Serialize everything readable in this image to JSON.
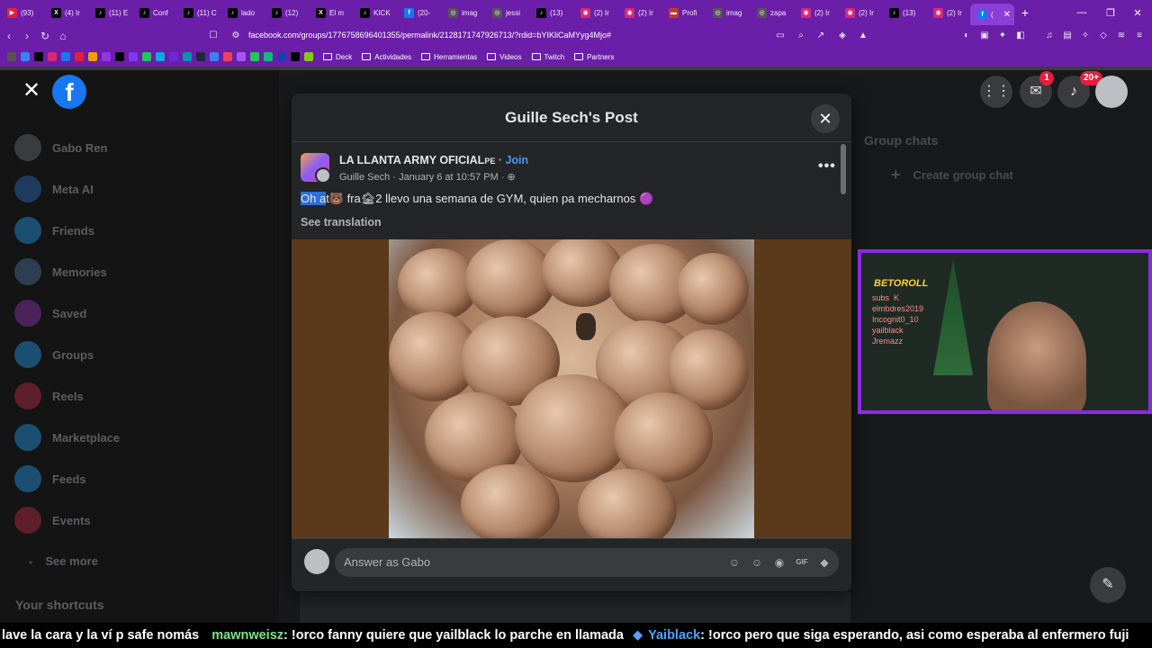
{
  "browser": {
    "tabs": [
      {
        "label": "(93)",
        "color": "#e41e3f",
        "glyph": "▶"
      },
      {
        "label": "(4) Ir",
        "color": "#000000",
        "glyph": "X"
      },
      {
        "label": "(11) E",
        "color": "#000000",
        "glyph": "♪"
      },
      {
        "label": "Conf",
        "color": "#000000",
        "glyph": "♪"
      },
      {
        "label": "(11) C",
        "color": "#000000",
        "glyph": "♪"
      },
      {
        "label": "lado",
        "color": "#000000",
        "glyph": "♪"
      },
      {
        "label": "(12) ",
        "color": "#000000",
        "glyph": "♪"
      },
      {
        "label": "El m",
        "color": "#000000",
        "glyph": "X"
      },
      {
        "label": "KICK",
        "color": "#000000",
        "glyph": "♪"
      },
      {
        "label": "(20-",
        "color": "#1877f2",
        "glyph": "f"
      },
      {
        "label": "imag",
        "color": "#555555",
        "glyph": "◎"
      },
      {
        "label": "jessi",
        "color": "#555555",
        "glyph": "◎"
      },
      {
        "label": "(13) ",
        "color": "#000000",
        "glyph": "♪"
      },
      {
        "label": "(2) Ir",
        "color": "#d62976",
        "glyph": "◉"
      },
      {
        "label": "(2) Ir",
        "color": "#d62976",
        "glyph": "◉"
      },
      {
        "label": "Profi",
        "color": "#c0392b",
        "glyph": "▬"
      },
      {
        "label": "imag",
        "color": "#555555",
        "glyph": "◎"
      },
      {
        "label": "zapa",
        "color": "#555555",
        "glyph": "◎"
      },
      {
        "label": "(2) Ir",
        "color": "#d62976",
        "glyph": "◉"
      },
      {
        "label": "(2) Ir",
        "color": "#d62976",
        "glyph": "◉"
      },
      {
        "label": "(13) ",
        "color": "#000000",
        "glyph": "♪"
      },
      {
        "label": "(2) Ir",
        "color": "#d62976",
        "glyph": "◉"
      },
      {
        "label": "(",
        "color": "#1877f2",
        "glyph": "f",
        "active": true
      }
    ],
    "url": "facebook.com/groups/1776758696401355/permalink/2128171747926713/?rdid=bYIKliCaMYyg4Mjo#",
    "bookmark_folders": [
      "Deck",
      "Actividades",
      "Herramientas",
      "Videos",
      "Twitch",
      "Partners"
    ]
  },
  "sidebar": {
    "items": [
      {
        "label": "Gabo Ren",
        "icon": "avatar",
        "color": "#3a3b3c"
      },
      {
        "label": "Meta AI",
        "icon": "meta-ai-icon",
        "color": "#1e3a5f"
      },
      {
        "label": "Friends",
        "icon": "friends-icon",
        "color": "#1b4f72"
      },
      {
        "label": "Memories",
        "icon": "memories-icon",
        "color": "#2c3e50"
      },
      {
        "label": "Saved",
        "icon": "saved-icon",
        "color": "#4a235a"
      },
      {
        "label": "Groups",
        "icon": "groups-icon",
        "color": "#1b4f72"
      },
      {
        "label": "Reels",
        "icon": "reels-icon",
        "color": "#5e1e2a"
      },
      {
        "label": "Marketplace",
        "icon": "marketplace-icon",
        "color": "#1b4f72"
      },
      {
        "label": "Feeds",
        "icon": "feeds-icon",
        "color": "#1b4f72"
      },
      {
        "label": "Events",
        "icon": "events-icon",
        "color": "#5e1e2a"
      }
    ],
    "see_more": "See more",
    "shortcuts": "Your shortcuts"
  },
  "header": {
    "messenger_badge": "1",
    "notifications_badge": "20+"
  },
  "right_column": {
    "group_chats": "Group chats",
    "create_group_chat": "Create group chat"
  },
  "modal": {
    "title": "Guille Sech's Post",
    "group_name": "LA LLANTA ARMY OFICIAL",
    "group_suffix": "PE",
    "join": "Join",
    "author": "Guille Sech",
    "date": "January 6 at 10:57 PM",
    "post_highlighted": "Oh a",
    "post_text": "t🐻 fra🏚2 llevo una semana de GYM, quien pa mecharnos 🟣",
    "see_translation": "See translation",
    "comment_placeholder": "Answer as Gabo"
  },
  "stream_overlay": {
    "label": "BETOROLL",
    "chat_lines": "subs  K\nelmbdres2019\nIncognit0_10\nyailblack\nJremazz"
  },
  "ticker": {
    "lead": "lave la cara y la ví p safe nomás",
    "user1": "mawnweisz",
    "msg1": ": !orco fanny quiere que yailblack lo parche en llamada",
    "user2": "Yaiblack",
    "msg2": ": !orco pero que siga esperando, asi como esperaba al enfermero fuji"
  }
}
